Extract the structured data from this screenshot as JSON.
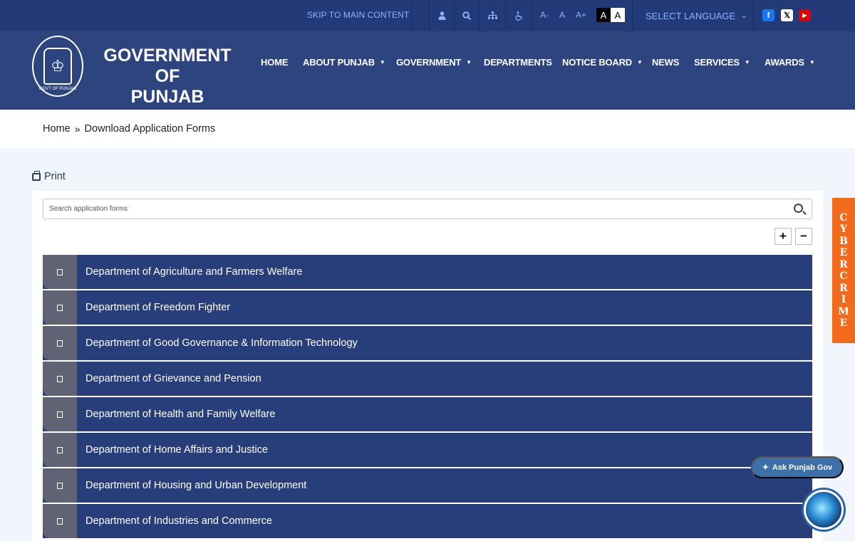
{
  "topbar": {
    "skip_link": "SKIP TO MAIN CONTENT",
    "icons": [
      "user-icon",
      "search-icon",
      "sitemap-icon",
      "accessibility-icon"
    ],
    "font_sizes": [
      "A-",
      "A",
      "A+"
    ],
    "contrast": [
      "A",
      "A"
    ],
    "language": "SELECT LANGUAGE",
    "social": [
      {
        "name": "facebook-icon",
        "glyph": "f"
      },
      {
        "name": "x-icon",
        "glyph": "𝕏"
      },
      {
        "name": "youtube-icon",
        "glyph": "▶"
      }
    ]
  },
  "header": {
    "brand_line1": "GOVERNMENT OF",
    "brand_line2": "PUNJAB",
    "emblem_caption": "GOVT OF PUNJAB",
    "nav": [
      {
        "label": "HOME",
        "dropdown": false
      },
      {
        "label": "ABOUT PUNJAB",
        "dropdown": true
      },
      {
        "label": "GOVERNMENT",
        "dropdown": true
      },
      {
        "label": "DEPARTMENTS",
        "dropdown": false
      },
      {
        "label": "NOTICE BOARD",
        "dropdown": true
      },
      {
        "label": "NEWS",
        "dropdown": false
      },
      {
        "label": "SERVICES",
        "dropdown": true
      },
      {
        "label": "AWARDS",
        "dropdown": true
      }
    ]
  },
  "breadcrumb": {
    "home": "Home",
    "separator": "»",
    "current": "Download Application Forms"
  },
  "print_label": "Print",
  "search": {
    "placeholder": "Search application forms",
    "value": ""
  },
  "controls": {
    "expand": "+",
    "collapse": "−"
  },
  "departments": [
    "Department of Agriculture and Farmers Welfare",
    "Department of Freedom Fighter",
    "Department of Good Governance & Information Technology",
    "Department of Grievance and Pension",
    "Department of Health and Family Welfare",
    "Department of Home Affairs and Justice",
    "Department of Housing and Urban Development",
    "Department of Industries and Commerce"
  ],
  "cyber_crime_letters": [
    "C",
    "Y",
    "B",
    "E",
    "R",
    "C",
    "R",
    "I",
    "M",
    "E"
  ],
  "ask_button": "Ask Punjab Gov",
  "colors": {
    "topbar": "#223a78",
    "header": "#2d447f",
    "accordion": "#283e7a",
    "accordion_tab": "#5f6374",
    "cyber_crime": "#f26a1b"
  }
}
